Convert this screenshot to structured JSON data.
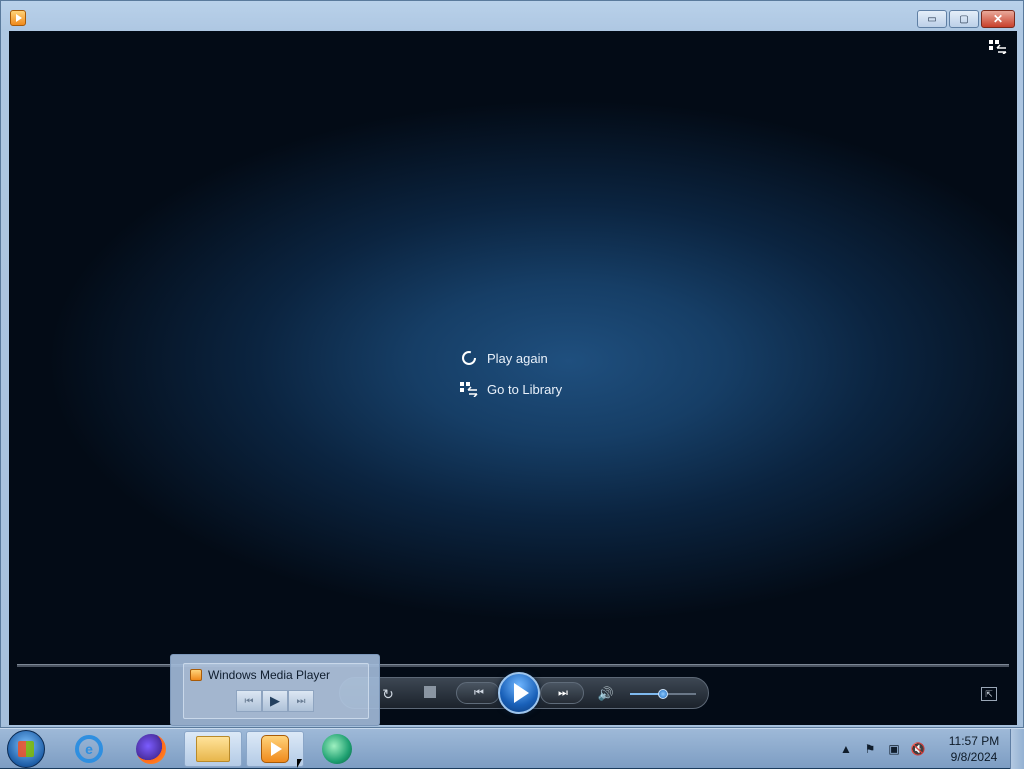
{
  "window": {
    "title": "",
    "buttons": {
      "minimize": "▭",
      "maximize": "▢",
      "close": "✕"
    }
  },
  "player": {
    "menu": [
      {
        "label": "Play again",
        "icon": "replay-icon"
      },
      {
        "label": "Go to Library",
        "icon": "library-icon"
      }
    ],
    "volume_level": 0.5
  },
  "controls": {
    "repeat": "↻",
    "prev": "⏮",
    "next": "⏭",
    "mute": "🔊"
  },
  "thumbnail": {
    "title": "Windows Media Player",
    "buttons": [
      "⏮",
      "▶",
      "⏭"
    ]
  },
  "taskbar": {
    "apps": [
      "internet-explorer",
      "firefox",
      "file-explorer",
      "windows-media-player",
      "other-app"
    ],
    "clock_time": "11:57 PM",
    "clock_date": "9/8/2024"
  },
  "colors": {
    "accent": "#1960b8",
    "close": "#c8402b",
    "wmp_orange": "#f08a1c"
  }
}
